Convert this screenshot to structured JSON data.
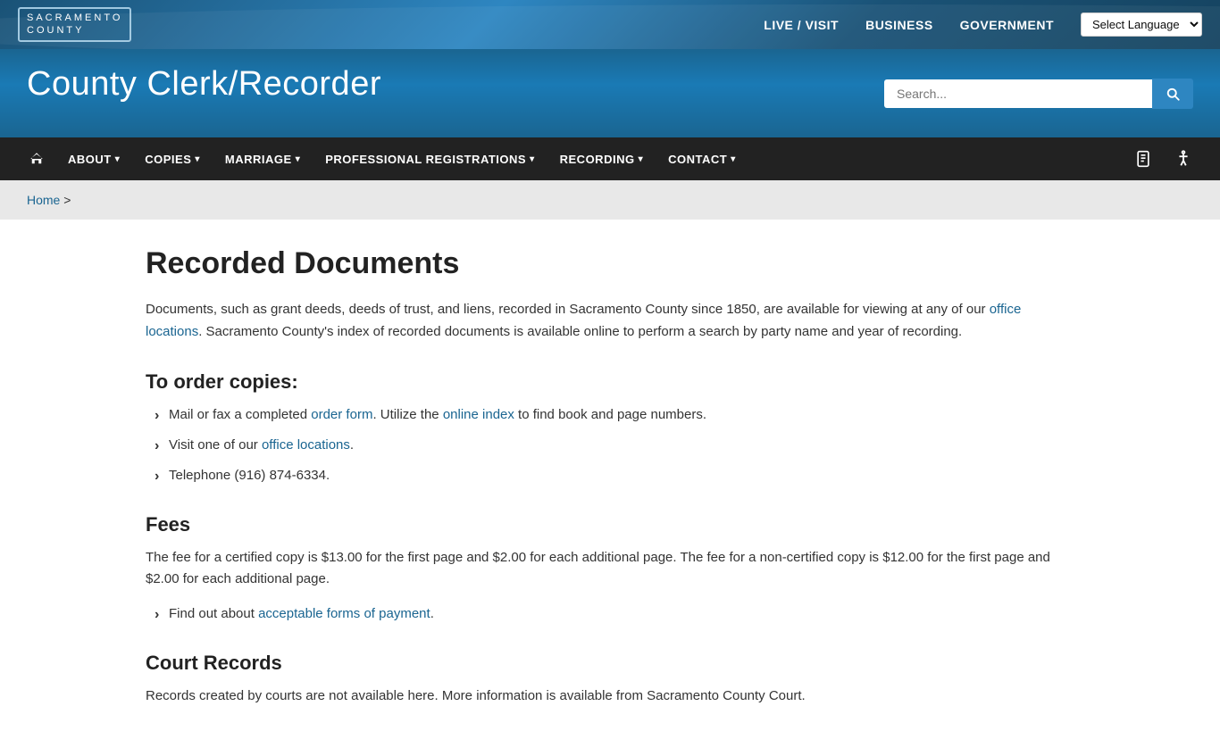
{
  "topbar": {
    "logo_line1": "SACRAMENTO",
    "logo_line2": "COUNTY",
    "nav_items": [
      {
        "label": "LIVE / VISIT",
        "id": "live-visit"
      },
      {
        "label": "BUSINESS",
        "id": "business"
      },
      {
        "label": "GOVERNMENT",
        "id": "government"
      }
    ],
    "language_label": "Select Language"
  },
  "header": {
    "site_title": "County Clerk/Recorder",
    "search_placeholder": "Search..."
  },
  "mainnav": {
    "home_title": "Home",
    "items": [
      {
        "label": "ABOUT",
        "has_dropdown": true
      },
      {
        "label": "COPIES",
        "has_dropdown": true
      },
      {
        "label": "MARRIAGE",
        "has_dropdown": true
      },
      {
        "label": "PROFESSIONAL REGISTRATIONS",
        "has_dropdown": true
      },
      {
        "label": "RECORDING",
        "has_dropdown": true
      },
      {
        "label": "CONTACT",
        "has_dropdown": true
      }
    ]
  },
  "breadcrumb": {
    "home_label": "Home",
    "separator": ">"
  },
  "page": {
    "title": "Recorded Documents",
    "intro_text_before_link": "Documents, such as grant deeds, deeds of trust, and liens, recorded in Sacramento County since 1850, are available for viewing at any of our ",
    "office_locations_link": "office locations",
    "intro_text_after_link": ". Sacramento County's index of recorded documents is available online to perform a search by party name and year of recording.",
    "order_heading": "To order copies:",
    "order_bullets": [
      {
        "prefix": "Mail or fax a completed ",
        "link1_text": "order form",
        "mid1": ". Utilize the ",
        "link2_text": "online index",
        "suffix": " to find book and page numbers."
      },
      {
        "prefix": "Visit one of our ",
        "link1_text": "office locations",
        "suffix": "."
      },
      {
        "prefix": "Telephone (916) 874-6334."
      }
    ],
    "fees_heading": "Fees",
    "fees_text": "The fee for a certified copy is $13.00 for the first page and $2.00 for each additional page. The fee for a non-certified copy is $12.00 for the first page and $2.00 for each additional page.",
    "fees_bullet_prefix": "Find out about ",
    "fees_bullet_link": "acceptable forms of payment",
    "fees_bullet_suffix": ".",
    "court_heading": "Court Records",
    "court_text": "Records created by courts are not available here. More information is available from Sacramento County Court."
  }
}
